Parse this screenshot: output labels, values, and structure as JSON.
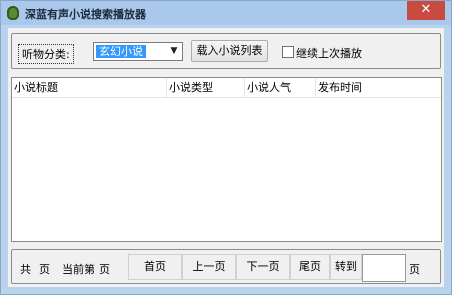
{
  "window": {
    "title": "深蓝有声小说搜索播放器",
    "close_glyph": "✕"
  },
  "filter": {
    "category_label": "听物分类:",
    "category_value": "玄幻小说",
    "load_button": "载入小说列表",
    "resume_label": "继续上次播放",
    "resume_checked": false
  },
  "table": {
    "columns": [
      "小说标题",
      "小说类型",
      "小说人气",
      "发布时间"
    ],
    "rows": []
  },
  "pager": {
    "total_prefix": "共",
    "total_suffix": "页",
    "current_prefix": "当前第",
    "current_suffix": "页",
    "first": "首页",
    "prev": "上一页",
    "next": "下一页",
    "last": "尾页",
    "goto": "转到",
    "goto_suffix": "页",
    "goto_value": ""
  },
  "colors": {
    "title_bar": "#a9c8ec",
    "close_button": "#c84b41",
    "selection": "#3399ff"
  }
}
